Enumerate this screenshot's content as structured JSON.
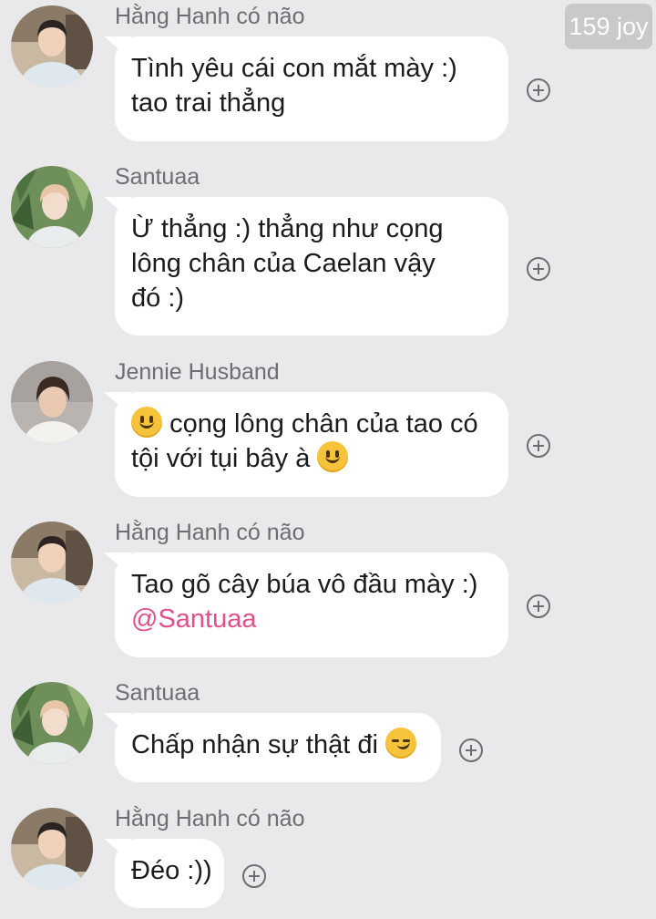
{
  "watermark": "159 joy",
  "messages": [
    {
      "sender": "Hằng Hanh có não",
      "lines": [
        "Tình yêu cái con mắt mày :)",
        "tao trai thẳng"
      ],
      "avatar": "avatar-boy-white-shirt"
    },
    {
      "sender": "Santuaa",
      "lines": [
        "Ừ thẳng :) thẳng như cọng",
        "lông chân của Caelan vậy",
        "đó :)"
      ],
      "avatar": "avatar-blond-boy-plants"
    },
    {
      "sender": "Jennie Husband",
      "lines": [
        "cọng lông chân của tao có",
        "tội với tụi bây à"
      ],
      "avatar": "avatar-dark-hair-boy"
    },
    {
      "sender": "Hằng Hanh có não",
      "lines": [
        "Tao gõ cây búa vô đầu mày :)"
      ],
      "mention": "@Santuaa",
      "avatar": "avatar-boy-white-shirt"
    },
    {
      "sender": "Santuaa",
      "lines": [
        "Chấp nhận sự thật đi"
      ],
      "avatar": "avatar-blond-boy-plants"
    },
    {
      "sender": "Hằng Hanh có não",
      "lines": [
        "Đéo :))"
      ],
      "avatar": "avatar-boy-white-shirt"
    }
  ],
  "icons": {
    "react": "add-reaction-icon",
    "smile": "slightly-smiling-face-emoji",
    "smirk": "smirking-face-emoji"
  },
  "colors": {
    "background": "#e9e9eb",
    "bubble": "#ffffff",
    "mention": "#e0508c",
    "sender": "#6d6d72"
  }
}
